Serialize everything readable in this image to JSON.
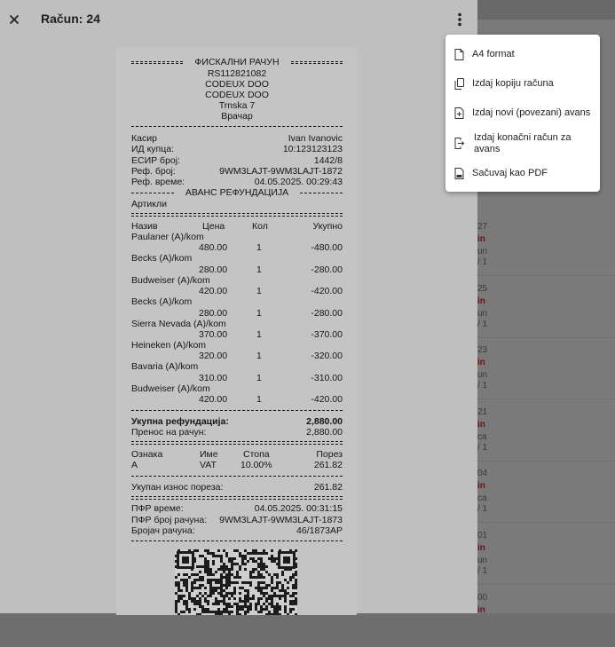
{
  "header": {
    "title": "Račun: 24"
  },
  "menu": {
    "items": [
      {
        "label": "A4 format",
        "icon": "file-icon"
      },
      {
        "label": "Izdaj kopiju računa",
        "icon": "copy-icon"
      },
      {
        "label": "Izdaj novi (povezani) avans",
        "icon": "file-plus-icon"
      },
      {
        "label": "Izdaj konačni račun za avans",
        "icon": "file-export-icon"
      },
      {
        "label": "Sačuvaj kao PDF",
        "icon": "pdf-icon"
      }
    ]
  },
  "receipt": {
    "header": [
      "ФИСКАЛНИ РАЧУН",
      "RS112821082",
      "CODEUX DOO",
      "CODEUX DOO",
      "Trnska 7",
      "Врачар"
    ],
    "info": [
      {
        "k": "Касир",
        "v": "Ivan Ivanovic"
      },
      {
        "k": "ИД купца:",
        "v": "10:123123123"
      },
      {
        "k": "ЕСИР број:",
        "v": "1442/8"
      },
      {
        "k": "Реф. број:",
        "v": "9WM3LAJT-9WM3LAJT-1872"
      },
      {
        "k": "Реф. време:",
        "v": "04.05.2025. 00:29:43"
      }
    ],
    "type_label": "АВАНС РЕФУНДАЦИЈА",
    "articles_label": "Артикли",
    "item_cols": [
      "Назив",
      "Цена",
      "Кол",
      "Укупно"
    ],
    "items": [
      {
        "name": "Paulaner (A)/kom",
        "price": "480.00",
        "qty": "1",
        "total": "-480.00"
      },
      {
        "name": "Becks (A)/kom",
        "price": "280.00",
        "qty": "1",
        "total": "-280.00"
      },
      {
        "name": "Budweiser (A)/kom",
        "price": "420.00",
        "qty": "1",
        "total": "-420.00"
      },
      {
        "name": "Becks (A)/kom",
        "price": "280.00",
        "qty": "1",
        "total": "-280.00"
      },
      {
        "name": "Sierra Nevada (A)/kom",
        "price": "370.00",
        "qty": "1",
        "total": "-370.00"
      },
      {
        "name": "Heineken (A)/kom",
        "price": "320.00",
        "qty": "1",
        "total": "-320.00"
      },
      {
        "name": "Bavaria (A)/kom",
        "price": "310.00",
        "qty": "1",
        "total": "-310.00"
      },
      {
        "name": "Budweiser (A)/kom",
        "price": "420.00",
        "qty": "1",
        "total": "-420.00"
      }
    ],
    "total_label": "Укупна рефундација:",
    "total_value": "2,880.00",
    "transfer_label": "Пренос на рачун:",
    "transfer_value": "2,880.00",
    "tax_cols": [
      "Ознака",
      "Име",
      "Стопа",
      "Порез"
    ],
    "tax_row": [
      "A",
      "VAT",
      "10.00%",
      "261.82"
    ],
    "tax_total_label": "Укупан износ пореза:",
    "tax_total_value": "261.82",
    "pfr": [
      {
        "k": "ПФР време:",
        "v": "04.05.2025. 00:31:15"
      },
      {
        "k": "ПФР број рачуна:",
        "v": "9WM3LAJT-9WM3LAJT-1873"
      },
      {
        "k": "Бројач рачуна:",
        "v": "46/1873АР"
      }
    ]
  },
  "background_list": [
    {
      "a": "27",
      "b": "in",
      "c": "un",
      "d": "/ 1"
    },
    {
      "a": "25",
      "b": "in",
      "c": "un",
      "d": "/ 1"
    },
    {
      "a": "23",
      "b": "in",
      "c": "un",
      "d": "/ 1"
    },
    {
      "a": "21",
      "b": "in",
      "c": "ca",
      "d": "/ 1"
    },
    {
      "a": "04",
      "b": "in",
      "c": "ca",
      "d": "/ 1"
    },
    {
      "a": "01",
      "b": "in",
      "c": "un",
      "d": "/ 1"
    },
    {
      "a": "00",
      "b": "in",
      "c": "",
      "d": ""
    }
  ],
  "colors": {
    "overlay_panel": "#bfbfbf",
    "menu_bg": "#ffffff",
    "accent_red": "#6a1414"
  }
}
